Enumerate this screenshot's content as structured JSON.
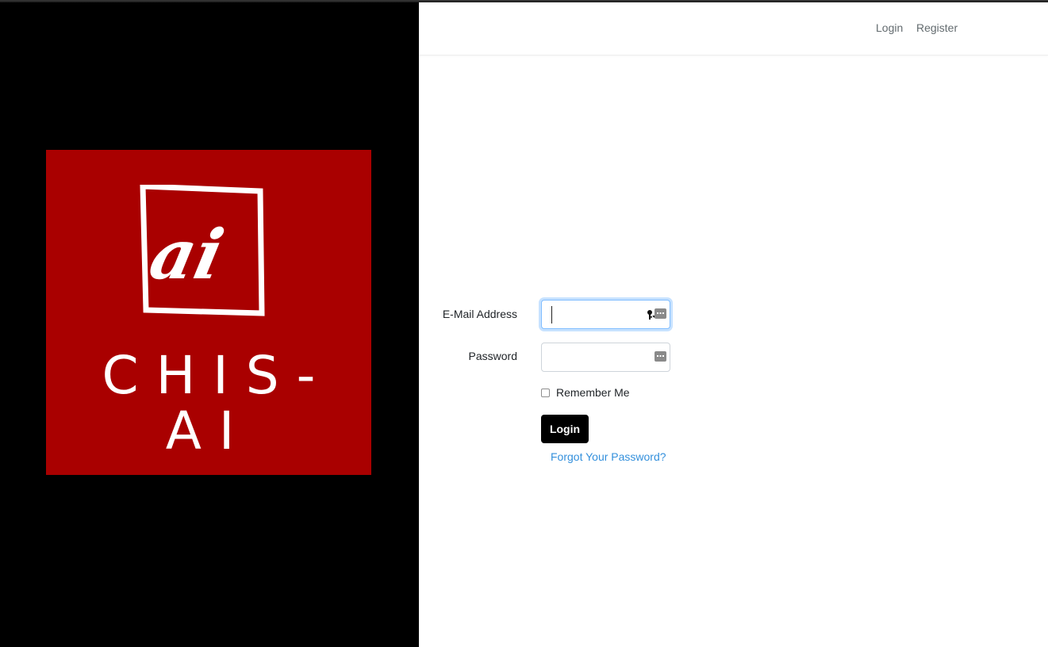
{
  "brand": {
    "logo_text": "CHIS-AI",
    "logo_mark": "ai",
    "colors": {
      "logo_background": "#a90000",
      "panel_background": "#000000",
      "accent": "#80bdff",
      "link": "#3490dc"
    }
  },
  "nav": {
    "login_label": "Login",
    "register_label": "Register"
  },
  "form": {
    "email_label": "E-Mail Address",
    "email_value": "",
    "password_label": "Password",
    "password_value": "",
    "remember_label": "Remember Me",
    "remember_checked": false,
    "submit_label": "Login",
    "forgot_label": "Forgot Your Password?"
  },
  "icons": {
    "email_autofill": "key-icon",
    "password_manager": "password-manager-icon"
  }
}
